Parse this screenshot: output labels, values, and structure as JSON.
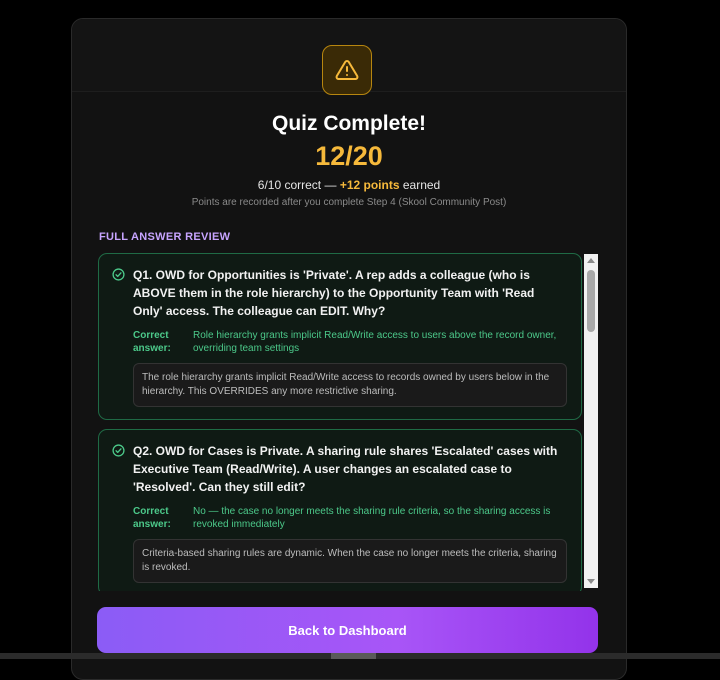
{
  "header": {
    "icon": "warning-triangle-icon",
    "title": "Quiz Complete!",
    "score": "12/20",
    "summary_prefix": "6/10 correct —",
    "summary_points": "+12 points",
    "summary_suffix": "earned",
    "note": "Points are recorded after you complete Step 4 (Skool Community Post)"
  },
  "review": {
    "heading": "FULL ANSWER REVIEW",
    "questions": [
      {
        "text": "Q1. OWD for Opportunities is 'Private'. A rep adds a colleague (who is ABOVE them in the role hierarchy) to the Opportunity Team with 'Read Only' access. The colleague can EDIT. Why?",
        "answer_label": "Correct answer:",
        "answer": "Role hierarchy grants implicit Read/Write access to users above the record owner, overriding team settings",
        "explanation": "The role hierarchy grants implicit Read/Write access to records owned by users below in the hierarchy. This OVERRIDES any more restrictive sharing."
      },
      {
        "text": "Q2. OWD for Cases is Private. A sharing rule shares 'Escalated' cases with Executive Team (Read/Write). A user changes an escalated case to 'Resolved'. Can they still edit?",
        "answer_label": "Correct answer:",
        "answer": "No — the case no longer meets the sharing rule criteria, so the sharing access is revoked immediately",
        "explanation": "Criteria-based sharing rules are dynamic. When the case no longer meets the criteria, sharing is revoked."
      }
    ]
  },
  "actions": {
    "back_label": "Back to Dashboard"
  },
  "colors": {
    "accent": "#a855f7",
    "score": "#f6b93b",
    "correct": "#4cc98a"
  }
}
